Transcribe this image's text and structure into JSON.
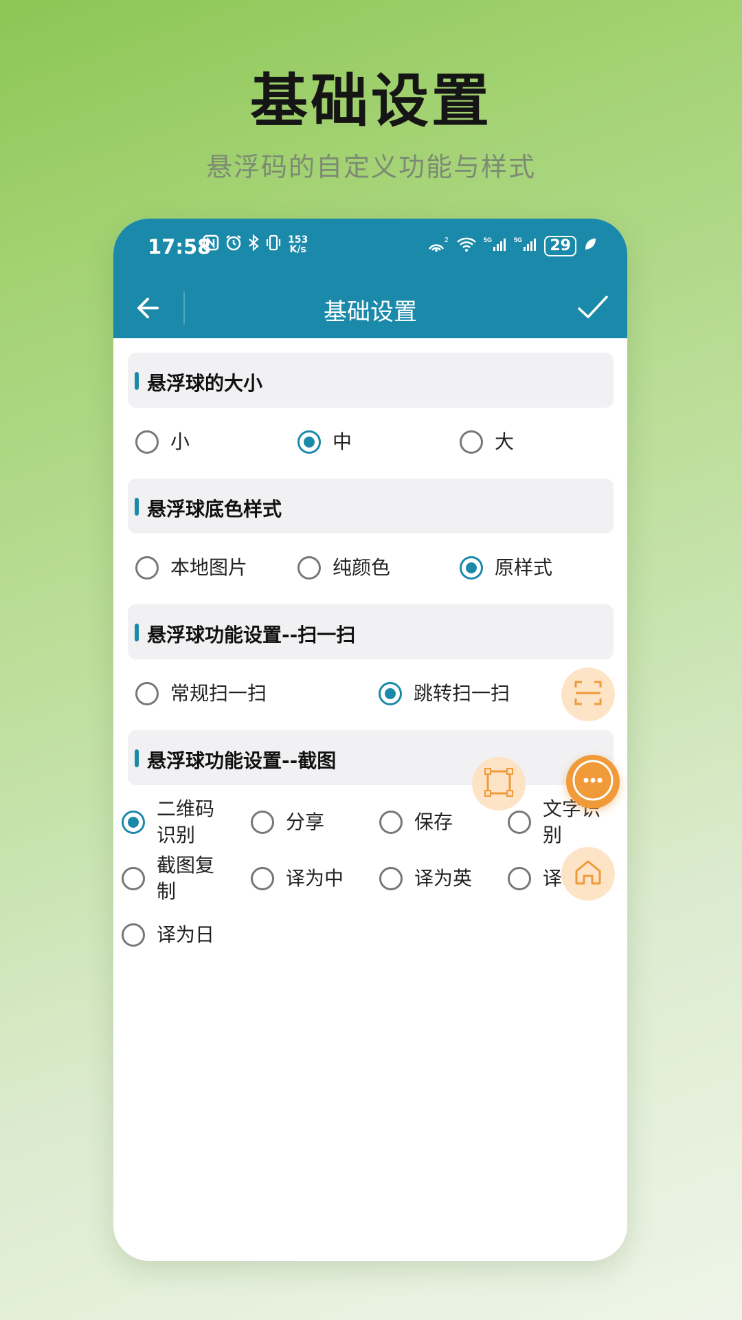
{
  "promo": {
    "title": "基础设置",
    "subtitle": "悬浮码的自定义功能与样式"
  },
  "status_bar": {
    "time": "17:58",
    "net_speed_value": "153",
    "net_speed_unit": "K/s",
    "battery": "29",
    "left_icons": [
      "nfc-icon",
      "alarm-icon",
      "bluetooth-icon",
      "vibrate-icon"
    ],
    "right_icons": [
      "hotspot-icon",
      "wifi-icon",
      "signal-5g-icon",
      "signal-5g-icon",
      "battery-icon",
      "leaf-icon"
    ]
  },
  "toolbar": {
    "title": "基础设置"
  },
  "sections": {
    "size": {
      "title": "悬浮球的大小",
      "options": [
        "小",
        "中",
        "大"
      ],
      "selected": "中"
    },
    "bg_style": {
      "title": "悬浮球底色样式",
      "options": [
        "本地图片",
        "纯颜色",
        "原样式"
      ],
      "selected": "原样式"
    },
    "scan": {
      "title": "悬浮球功能设置--扫一扫",
      "options": [
        "常规扫一扫",
        "跳转扫一扫"
      ],
      "selected": "跳转扫一扫"
    },
    "screenshot": {
      "title": "悬浮球功能设置--截图",
      "options": [
        "二维码识别",
        "分享",
        "保存",
        "文字识别",
        "截图复制",
        "译为中",
        "译为英",
        "译",
        "译为日"
      ],
      "selected": "二维码识别"
    }
  },
  "colors": {
    "primary": "#1b89a9",
    "accent": "#f09a3a",
    "section_bg": "#f1f1f3"
  }
}
